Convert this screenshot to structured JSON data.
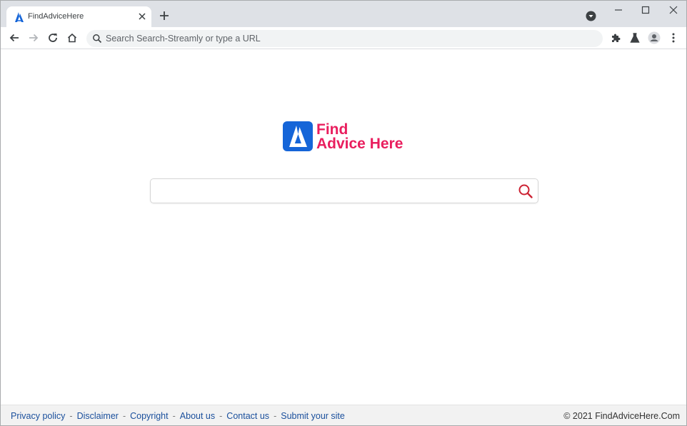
{
  "browser": {
    "tab": {
      "title": "FindAdviceHere",
      "favicon": "findadvice-logo-icon"
    },
    "omnibox": {
      "placeholder": "Search Search-Streamly or type a URL",
      "value": ""
    },
    "icons": [
      "back-arrow-icon",
      "forward-arrow-icon",
      "reload-icon",
      "home-icon",
      "search-icon",
      "extensions-icon",
      "labs-flask-icon",
      "profile-avatar-icon",
      "menu-kebab-icon",
      "tab-search-icon",
      "minimize-icon",
      "maximize-icon",
      "close-window-icon",
      "new-tab-plus-icon"
    ]
  },
  "page": {
    "logo": {
      "line1": "Find",
      "line2": "Advice Here",
      "mark_color": "#1565d8",
      "text_color": "#e91e5e"
    },
    "search": {
      "placeholder": "",
      "value": "",
      "button_icon": "search-icon",
      "button_color": "#cc2233"
    }
  },
  "footer": {
    "links": [
      "Privacy policy",
      "Disclaimer",
      "Copyright",
      "About us",
      "Contact us",
      "Submit your site"
    ],
    "separator": "-",
    "copyright": "© 2021 FindAdviceHere.Com",
    "link_color": "#1a4f9c"
  }
}
